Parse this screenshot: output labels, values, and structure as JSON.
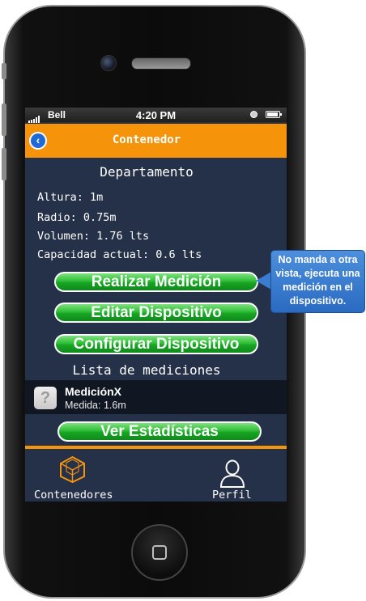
{
  "status_bar": {
    "carrier": "Bell",
    "time": "4:20 PM"
  },
  "nav": {
    "title": "Contenedor"
  },
  "detail": {
    "section_title": "Departamento",
    "fields": [
      "Altura: 1m",
      "Radio: 0.75m",
      "Volumen: 1.76 lts",
      "Capacidad actual: 0.6 lts"
    ]
  },
  "buttons": {
    "realizar": "Realizar Medición",
    "editar": "Editar Dispositivo",
    "configurar": "Configurar Dispositivo",
    "estadisticas": "Ver Estadísticas"
  },
  "mediciones": {
    "title": "Lista de mediciones",
    "items": [
      {
        "name": "MediciónX",
        "value": "Medida: 1.6m",
        "icon": "?"
      }
    ]
  },
  "tabs": [
    {
      "label": "Contenedores",
      "icon": "cube-icon"
    },
    {
      "label": "Perfil",
      "icon": "person-icon"
    }
  ],
  "annotation": {
    "text": "No manda a otra vista, ejecuta una medición en el dispositivo."
  },
  "colors": {
    "accent": "#f5940b",
    "screen_bg": "#253049",
    "button_green": "#2fbf37",
    "callout_blue": "#3a7dd0"
  }
}
